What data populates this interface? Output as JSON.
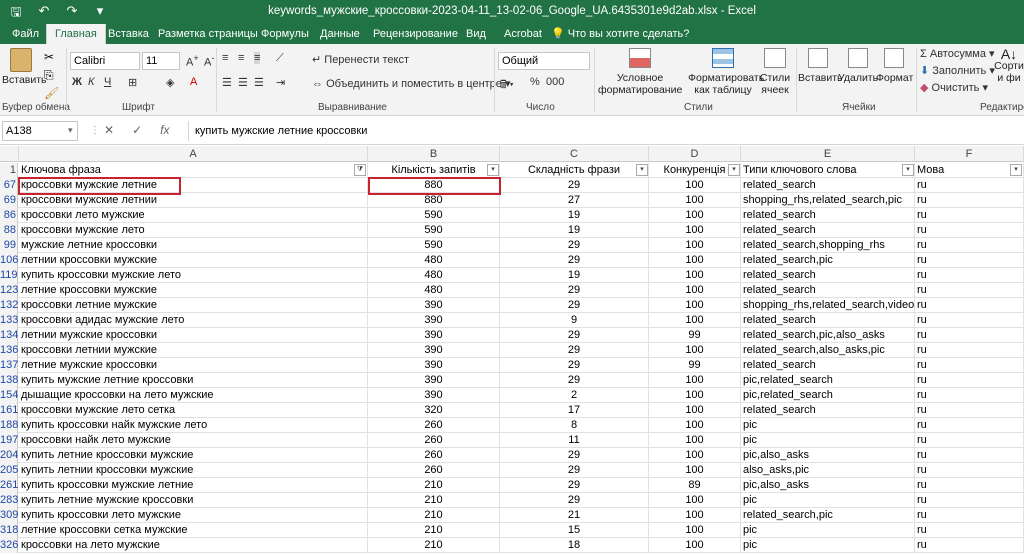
{
  "window": {
    "title": "keywords_мужские_кроссовки-2023-04-11_13-02-06_Google_UA.6435301e9d2ab.xlsx  -  Excel"
  },
  "tabs": [
    "Файл",
    "Главная",
    "Вставка",
    "Разметка страницы",
    "Формулы",
    "Данные",
    "Рецензирование",
    "Вид",
    "Acrobat"
  ],
  "tell_me": "Что вы хотите сделать?",
  "ribbon": {
    "clipboard": {
      "paste": "Вставить",
      "label": "Буфер обмена"
    },
    "font": {
      "name": "Calibri",
      "size": "11",
      "label": "Шрифт"
    },
    "alignment": {
      "wrap": "Перенести текст",
      "merge": "Объединить и поместить в центре",
      "label": "Выравнивание"
    },
    "number": {
      "format": "Общий",
      "label": "Число"
    },
    "styles": {
      "conditional": "Условное форматирование",
      "as_table": "Форматировать как таблицу",
      "cell_styles": "Стили ячеек",
      "label": "Стили"
    },
    "cells": {
      "insert": "Вставить",
      "delete": "Удалить",
      "format": "Формат",
      "label": "Ячейки"
    },
    "editing": {
      "autosum": "Автосумма",
      "fill": "Заполнить",
      "clear": "Очистить",
      "sort": "Сорти и фи",
      "label": "Редактиров"
    }
  },
  "formula_bar": {
    "name_box": "A138",
    "formula": "купить мужские летние кроссовки"
  },
  "columns": [
    "A",
    "B",
    "C",
    "D",
    "E",
    "F"
  ],
  "header_row": {
    "num": "1",
    "cells": [
      "Ключова фраза",
      "Кількість запитів",
      "Складність фрази",
      "Конкуренція",
      "Типи ключового слова",
      "Мова"
    ]
  },
  "rows": [
    {
      "num": "67",
      "a": "кроссовки мужские летние",
      "b": "880",
      "c": "29",
      "d": "100",
      "e": "related_search",
      "f": "ru"
    },
    {
      "num": "69",
      "a": "кроссовки мужские летнии",
      "b": "880",
      "c": "27",
      "d": "100",
      "e": "shopping_rhs,related_search,pic",
      "f": "ru"
    },
    {
      "num": "86",
      "a": "кроссовки лето мужские",
      "b": "590",
      "c": "19",
      "d": "100",
      "e": "related_search",
      "f": "ru"
    },
    {
      "num": "88",
      "a": "кроссовки мужские лето",
      "b": "590",
      "c": "19",
      "d": "100",
      "e": "related_search",
      "f": "ru"
    },
    {
      "num": "99",
      "a": "мужские летние кроссовки",
      "b": "590",
      "c": "29",
      "d": "100",
      "e": "related_search,shopping_rhs",
      "f": "ru"
    },
    {
      "num": "106",
      "a": "летнии кроссовки мужские",
      "b": "480",
      "c": "29",
      "d": "100",
      "e": "related_search,pic",
      "f": "ru"
    },
    {
      "num": "119",
      "a": "купить кроссовки мужские лето",
      "b": "480",
      "c": "19",
      "d": "100",
      "e": "related_search",
      "f": "ru"
    },
    {
      "num": "123",
      "a": "летние кроссовки мужские",
      "b": "480",
      "c": "29",
      "d": "100",
      "e": "related_search",
      "f": "ru"
    },
    {
      "num": "132",
      "a": "кроссовки летние мужские",
      "b": "390",
      "c": "29",
      "d": "100",
      "e": "shopping_rhs,related_search,video",
      "f": "ru"
    },
    {
      "num": "133",
      "a": "кроссовки адидас мужские лето",
      "b": "390",
      "c": "9",
      "d": "100",
      "e": "related_search",
      "f": "ru"
    },
    {
      "num": "134",
      "a": "летнии мужские кроссовки",
      "b": "390",
      "c": "29",
      "d": "99",
      "e": "related_search,pic,also_asks",
      "f": "ru"
    },
    {
      "num": "136",
      "a": "кроссовки летнии мужские",
      "b": "390",
      "c": "29",
      "d": "100",
      "e": "related_search,also_asks,pic",
      "f": "ru"
    },
    {
      "num": "137",
      "a": "летние мужские кроссовки",
      "b": "390",
      "c": "29",
      "d": "99",
      "e": "related_search",
      "f": "ru"
    },
    {
      "num": "138",
      "a": "купить мужские летние кроссовки",
      "b": "390",
      "c": "29",
      "d": "100",
      "e": "pic,related_search",
      "f": "ru"
    },
    {
      "num": "154",
      "a": "дышащие кроссовки на лето мужские",
      "b": "390",
      "c": "2",
      "d": "100",
      "e": "pic,related_search",
      "f": "ru"
    },
    {
      "num": "161",
      "a": "кроссовки мужские лето сетка",
      "b": "320",
      "c": "17",
      "d": "100",
      "e": "related_search",
      "f": "ru"
    },
    {
      "num": "188",
      "a": "купить кроссовки найк мужские лето",
      "b": "260",
      "c": "8",
      "d": "100",
      "e": "pic",
      "f": "ru"
    },
    {
      "num": "197",
      "a": "кроссовки найк лето мужские",
      "b": "260",
      "c": "11",
      "d": "100",
      "e": "pic",
      "f": "ru"
    },
    {
      "num": "204",
      "a": "купить летние кроссовки мужские",
      "b": "260",
      "c": "29",
      "d": "100",
      "e": "pic,also_asks",
      "f": "ru"
    },
    {
      "num": "205",
      "a": "купить летнии кроссовки мужские",
      "b": "260",
      "c": "29",
      "d": "100",
      "e": "also_asks,pic",
      "f": "ru"
    },
    {
      "num": "261",
      "a": "купить кроссовки мужские летние",
      "b": "210",
      "c": "29",
      "d": "89",
      "e": "pic,also_asks",
      "f": "ru"
    },
    {
      "num": "283",
      "a": "купить летние мужские кроссовки",
      "b": "210",
      "c": "29",
      "d": "100",
      "e": "pic",
      "f": "ru"
    },
    {
      "num": "309",
      "a": "купить кроссовки лето мужские",
      "b": "210",
      "c": "21",
      "d": "100",
      "e": "related_search,pic",
      "f": "ru"
    },
    {
      "num": "318",
      "a": "летние кроссовки сетка мужские",
      "b": "210",
      "c": "15",
      "d": "100",
      "e": "pic",
      "f": "ru"
    },
    {
      "num": "326",
      "a": "кроссовки на лето мужские",
      "b": "210",
      "c": "18",
      "d": "100",
      "e": "pic",
      "f": "ru"
    }
  ],
  "highlight_color": "#c8232c",
  "accent": "#217346"
}
